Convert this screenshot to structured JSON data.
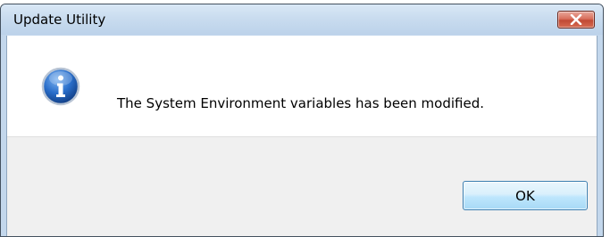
{
  "window": {
    "title": "Update Utility",
    "close_icon": "close-icon"
  },
  "message": {
    "icon": "info-icon",
    "text": "The System Environment variables has been modified."
  },
  "buttons": {
    "ok_label": "OK"
  },
  "colors": {
    "titlebar": "#c9dcef",
    "close_button": "#c14a35",
    "ok_button_border": "#3c7fb1",
    "info_icon": "#1f5eb8"
  }
}
